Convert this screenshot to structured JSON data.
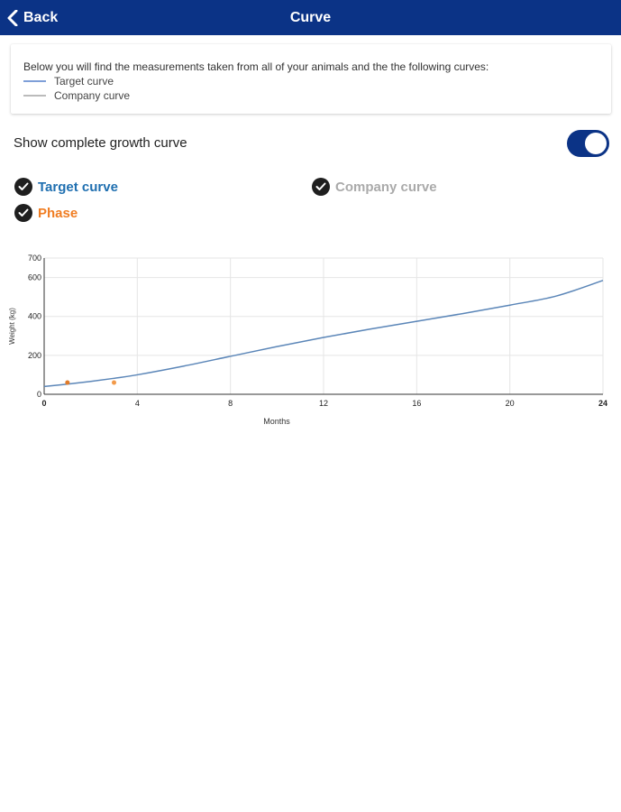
{
  "header": {
    "back_label": "Back",
    "title": "Curve"
  },
  "info": {
    "text": "Below you will find the measurements taken from all of your animals and the the following curves:",
    "legend": [
      {
        "label": "Target curve",
        "color": "#7e9fd8"
      },
      {
        "label": "Company curve",
        "color": "#bbbbbb"
      }
    ]
  },
  "toggle": {
    "label": "Show complete growth curve",
    "on": true
  },
  "filters": {
    "target": {
      "label": "Target curve",
      "color": "#1f6fb0"
    },
    "company": {
      "label": "Company curve",
      "color": "#aaaaaa"
    },
    "phase": {
      "label": "Phase",
      "color": "#f07d22"
    }
  },
  "chart_data": {
    "type": "line",
    "xlabel": "Months",
    "ylabel": "Weight (kg)",
    "xlim": [
      0,
      24
    ],
    "ylim": [
      0,
      700
    ],
    "x_ticks": [
      "0",
      "4",
      "8",
      "12",
      "16",
      "20",
      "24"
    ],
    "y_ticks": [
      "0",
      "200",
      "400",
      "600",
      "700"
    ],
    "grid": true,
    "series": [
      {
        "name": "Target curve",
        "color": "#5b86b8",
        "points": [
          [
            0,
            40
          ],
          [
            1,
            52
          ],
          [
            2,
            66
          ],
          [
            3,
            82
          ],
          [
            4,
            100
          ],
          [
            6,
            145
          ],
          [
            8,
            195
          ],
          [
            10,
            245
          ],
          [
            12,
            292
          ],
          [
            14,
            335
          ],
          [
            16,
            375
          ],
          [
            18,
            415
          ],
          [
            20,
            458
          ],
          [
            22,
            505
          ],
          [
            24,
            585
          ]
        ]
      }
    ],
    "measurements": [
      {
        "x": 1,
        "y": 60,
        "color": "#e07b2a"
      },
      {
        "x": 3,
        "y": 60,
        "color": "#f29a4a"
      }
    ],
    "tick_color": "#222222",
    "grid_color": "#e5e5e5"
  }
}
